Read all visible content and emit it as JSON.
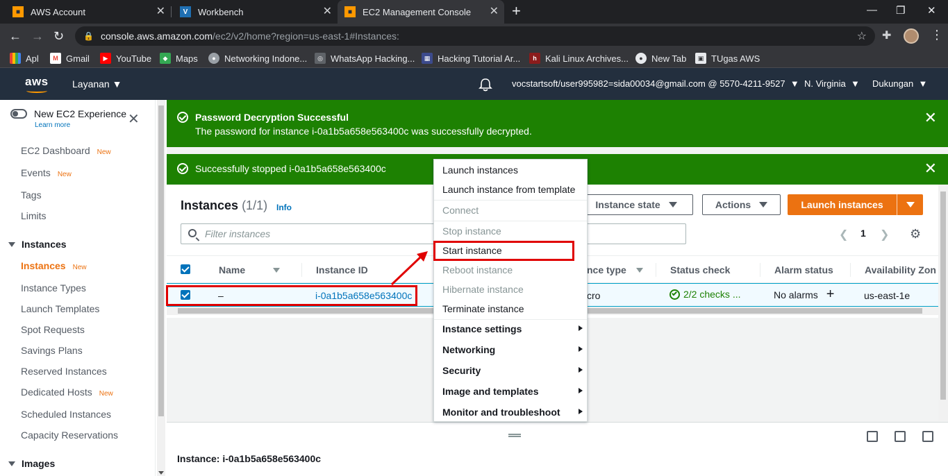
{
  "browser": {
    "tabs": [
      {
        "title": "AWS Account"
      },
      {
        "title": "Workbench"
      },
      {
        "title": "EC2 Management Console"
      }
    ],
    "url_host": "console.aws.amazon.com",
    "url_path": "/ec2/v2/home?region=us-east-1#Instances:",
    "bookmarks": [
      {
        "label": "Apl"
      },
      {
        "label": "Gmail"
      },
      {
        "label": "YouTube"
      },
      {
        "label": "Maps"
      },
      {
        "label": "Networking Indone..."
      },
      {
        "label": "WhatsApp Hacking..."
      },
      {
        "label": "Hacking Tutorial Ar..."
      },
      {
        "label": "Kali Linux Archives..."
      },
      {
        "label": "New Tab"
      },
      {
        "label": "TUgas AWS"
      }
    ]
  },
  "aws_header": {
    "logo": "aws",
    "services": "Layanan",
    "account": "vocstartsoft/user995982=sida00034@gmail.com @ 5570-4211-9527",
    "region": "N. Virginia",
    "support": "Dukungan"
  },
  "sidebar": {
    "experience_label": "New EC2 Experience",
    "learn_more": "Learn more",
    "new_badge": "New",
    "items": [
      {
        "label": "EC2 Dashboard"
      },
      {
        "label": "Events"
      },
      {
        "label": "Tags"
      },
      {
        "label": "Limits"
      }
    ],
    "section_instances": "Instances",
    "instances_items": [
      {
        "label": "Instances"
      },
      {
        "label": "Instance Types"
      },
      {
        "label": "Launch Templates"
      },
      {
        "label": "Spot Requests"
      },
      {
        "label": "Savings Plans"
      },
      {
        "label": "Reserved Instances"
      },
      {
        "label": "Dedicated Hosts"
      },
      {
        "label": "Scheduled Instances"
      },
      {
        "label": "Capacity Reservations"
      }
    ],
    "section_images": "Images"
  },
  "flash": {
    "decrypt_title": "Password Decryption Successful",
    "decrypt_msg": "The password for instance i-0a1b5a658e563400c was successfully decrypted.",
    "stopped_msg": "Successfully stopped i-0a1b5a658e563400c"
  },
  "instances": {
    "title": "Instances",
    "count": "(1/1)",
    "info": "Info",
    "instance_state": "Instance state",
    "actions": "Actions",
    "launch": "Launch instances",
    "filter_placeholder": "Filter instances",
    "page": "1",
    "columns": {
      "name": "Name",
      "id": "Instance ID",
      "type": "nce type",
      "status": "Status check",
      "alarm": "Alarm status",
      "az": "Availability Zon"
    },
    "row": {
      "name": "–",
      "id": "i-0a1b5a658e563400c",
      "type": "cro",
      "status": "2/2 checks ...",
      "alarm": "No alarms",
      "az": "us-east-1e"
    }
  },
  "details": {
    "title": "Instance: i-0a1b5a658e563400c"
  },
  "context_menu": {
    "launch_instances": "Launch instances",
    "launch_from_template": "Launch instance from template",
    "connect": "Connect",
    "stop": "Stop instance",
    "start": "Start instance",
    "reboot": "Reboot instance",
    "hibernate": "Hibernate instance",
    "terminate": "Terminate instance",
    "instance_settings": "Instance settings",
    "networking": "Networking",
    "security": "Security",
    "image_templates": "Image and templates",
    "monitor": "Monitor and troubleshoot"
  },
  "colors": {
    "aws_header": "#232f3e",
    "success": "#1d8102",
    "primary": "#ec7211",
    "link": "#0073bb",
    "annotation": "#e00000"
  }
}
